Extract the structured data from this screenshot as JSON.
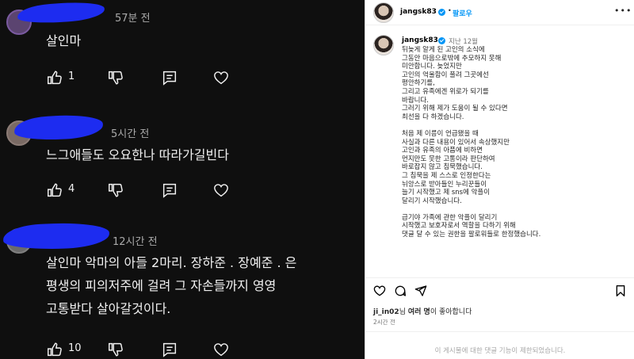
{
  "comments": [
    {
      "time": "57분 전",
      "text": [
        "살인마"
      ],
      "likes": "1"
    },
    {
      "time": "5시간 전",
      "text": [
        "느그애들도 오요한나 따라가길빈다"
      ],
      "likes": "4"
    },
    {
      "time": "12시간 전",
      "text": [
        "살인마 악마의 아들 2마리. 장하준 . 장예준 . 은",
        "평생의 피의저주에 걸려 그 자손들까지 영영",
        "고통받다 살아갈것이다."
      ],
      "likes": "10"
    }
  ],
  "post": {
    "username": "jangsk83",
    "follow_label": "팔로우",
    "more_label": "•••",
    "caption_time": "지난 12월",
    "caption": [
      "뒤늦게 알게 된 고인의 소식에",
      "그동안 마음으로밖에 추모하지 못해",
      "미안합니다. 늦었지만",
      "고인의 억울함이 풀려 그곳에선",
      "평안하기를,",
      "그리고 유족에겐 위로가 되기를",
      "바랍니다.",
      "그러기 위해 제가 도움이 될 수 있다면",
      "최선을 다 하겠습니다.",
      "",
      "처음 제 이름이 언급됐을 때",
      "사실과 다른 내용이 있어서 속상했지만",
      "고인과 유족의 아픔에 비하면",
      "먼지만도 못한 고통이라 판단하여",
      "바로잡지 않고 침묵했습니다.",
      "그 침묵을 제 스스로 인정한다는",
      "뉘앙스로 받아들인 누리꾼들이",
      "늘기 시작했고 제 sns에 악플이",
      "달리기 시작했습니다.",
      "",
      "급기야 가족에 관한 악플이 달리기",
      "시작했고 보호자로서 역할을 다하기 위해",
      "댓글 달 수 있는 권한을 팔로워들로 한정했습니다."
    ],
    "liked_by_user": "ji_in02",
    "liked_by_mid": "님 ",
    "liked_by_bold": "여러 명",
    "liked_by_suffix": "이 좋아합니다",
    "time_ago": "2시간 전",
    "comments_limited": "이 게시물에 대한 댓글 기능이 제한되었습니다."
  },
  "colors": {
    "dark_bg": "#0f0f0f",
    "accent_blue": "#0095f6",
    "redaction": "#1d2cf0"
  },
  "icons": [
    "thumb-up-icon",
    "thumb-down-icon",
    "reply-icon",
    "heart-icon",
    "comment-icon",
    "share-icon",
    "bookmark-icon",
    "verified-icon"
  ]
}
